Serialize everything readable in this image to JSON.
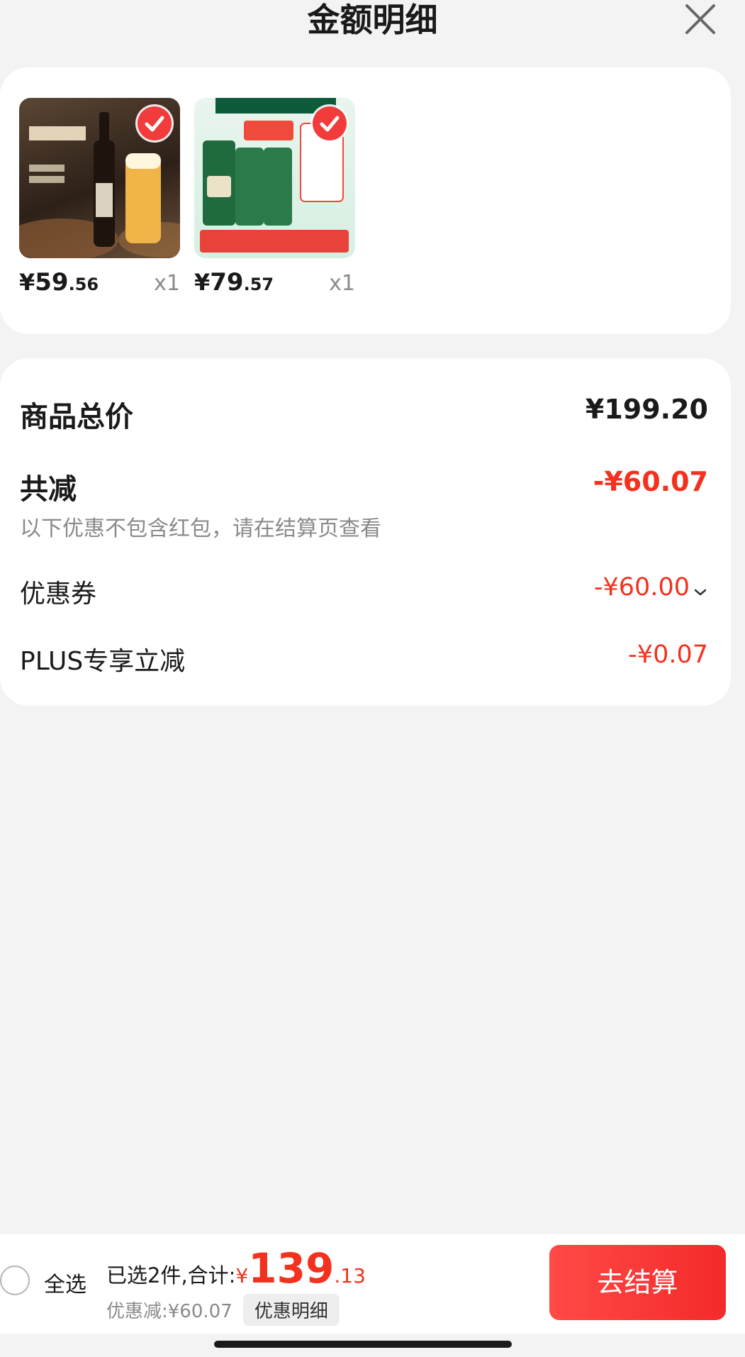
{
  "header": {
    "title": "金额明细"
  },
  "products": [
    {
      "price_symbol": "¥",
      "price_int": "59",
      "price_dec": ".56",
      "qty": "x1",
      "thumbnail": "beer-bottle-thumbnail",
      "selected": true
    },
    {
      "price_symbol": "¥",
      "price_int": "79",
      "price_dec": ".57",
      "qty": "x1",
      "thumbnail": "beer-cans-thumbnail",
      "selected": true
    }
  ],
  "summary": {
    "goods_total_label": "商品总价",
    "goods_total_value": "¥199.20",
    "reduction_label": "共减",
    "reduction_value": "-¥60.07",
    "reduction_note": "以下优惠不包含红包，请在结算页查看",
    "coupon_label": "优惠券",
    "coupon_value": "-¥60.00",
    "plus_label": "PLUS专享立减",
    "plus_value": "-¥0.07"
  },
  "bottom_bar": {
    "select_all_label": "全选",
    "selected_text": "已选2件,合计:",
    "total_symbol": "¥",
    "total_int": "139",
    "total_dec": ".13",
    "discount_text": "优惠减:¥60.07",
    "detail_button": "优惠明细",
    "checkout_button": "去结算"
  },
  "colors": {
    "accent_red": "#f2321e",
    "checkout_gradient_start": "#ff4a47",
    "checkout_gradient_end": "#f42a2a",
    "background": "#f3f3f3"
  },
  "icons": [
    "close-icon",
    "check-icon",
    "chevron-down-icon",
    "radio-unchecked-icon"
  ]
}
